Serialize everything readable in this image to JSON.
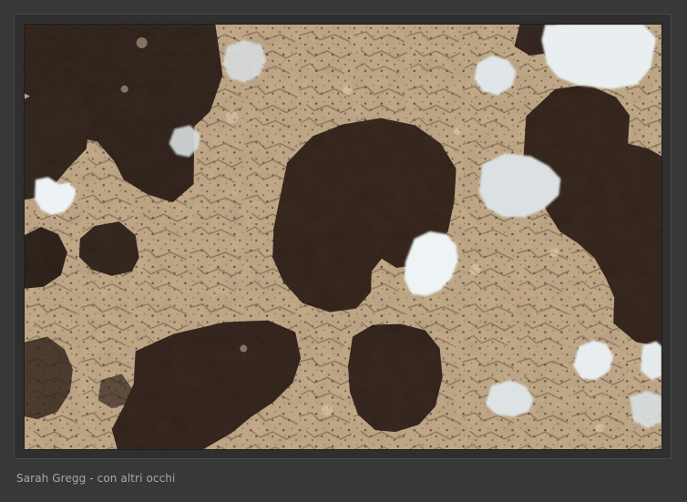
{
  "photo": {
    "subject": "lichen-on-rock",
    "colors": {
      "background": "#383838",
      "rock": "#c8b08e",
      "dark_lichen": "#2a1c14",
      "pale_lichen": "#e6ecef"
    }
  },
  "caption": {
    "text": "Sarah Gregg - con altri occhi"
  }
}
